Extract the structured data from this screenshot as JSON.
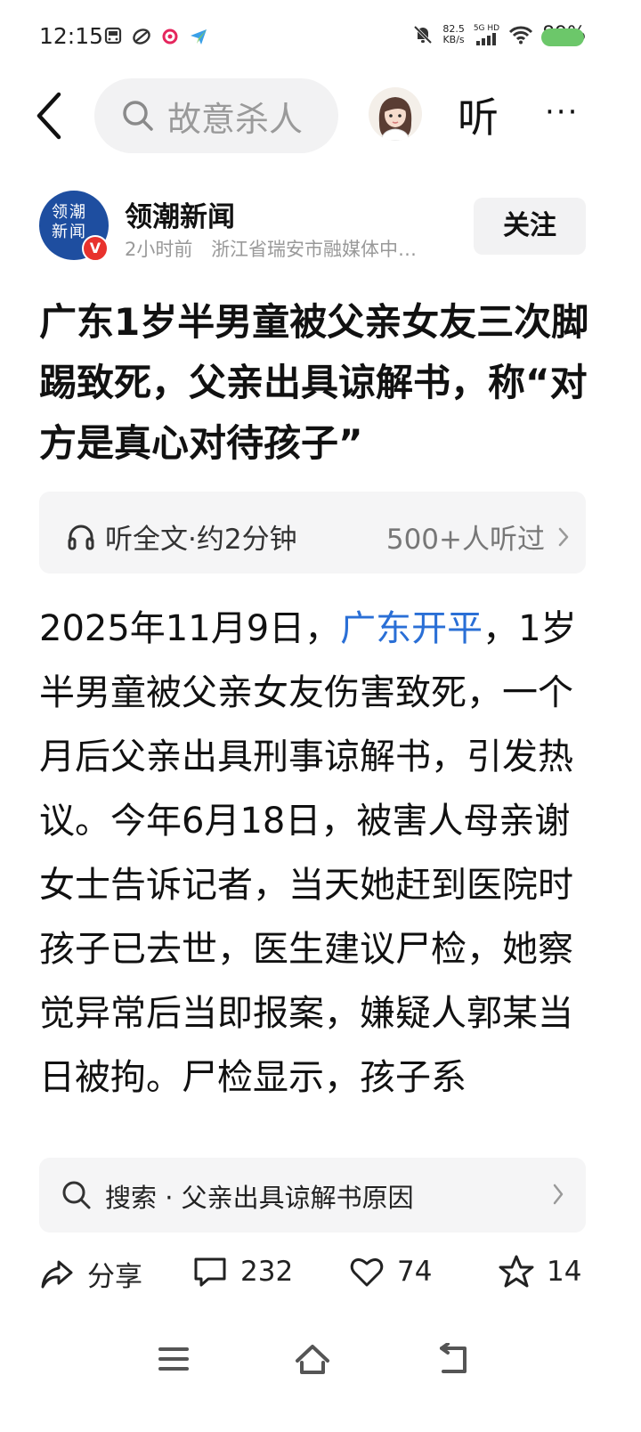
{
  "status_bar": {
    "time": "12:15",
    "speed_value": "82.5",
    "speed_unit": "KB/s",
    "network": "5G HD",
    "battery_percent": "89%",
    "battery_level": 0.89,
    "icons": [
      "bus-card-icon",
      "link-app-icon",
      "app-notification-icon",
      "message-app-icon",
      "mute-icon",
      "signal-icon",
      "wifi-icon",
      "battery-icon"
    ]
  },
  "top_nav": {
    "search_text": "故意杀人",
    "listen_label": "听",
    "more_label": "···"
  },
  "author": {
    "logo_text": "领潮新闻",
    "verified_mark": "V",
    "name": "领潮新闻",
    "time": "2小时前",
    "source": "浙江省瑞安市融媒体中…",
    "follow_label": "关注"
  },
  "article": {
    "title": "广东1岁半男童被父亲女友三次脚踢致死，父亲出具谅解书，称“对方是真心对待孩子”",
    "listen_bar": {
      "label": "听全文·约2分钟",
      "listeners": "500+人听过"
    },
    "body_prefix": "2025年11月9日，",
    "body_link": "广东开平",
    "body_rest": "，1岁半男童被父亲女友伤害致死，一个月后父亲出具刑事谅解书，引发热议。今年6月18日，被害人母亲谢女士告诉记者，当天她赶到医院时孩子已去世，医生建议尸检，她察觉异常后当即报案，嫌疑人郭某当日被拘。尸检显示，孩子系"
  },
  "related_search": {
    "prefix": "搜索 · ",
    "query": "父亲出具谅解书原因"
  },
  "actions": {
    "share_label": "分享",
    "comments": "232",
    "likes": "74",
    "favorites": "14"
  },
  "colors": {
    "link": "#2a6fd6",
    "logo_bg": "#1e4ea0",
    "verified": "#e8322d",
    "battery": "#6cc76a"
  }
}
